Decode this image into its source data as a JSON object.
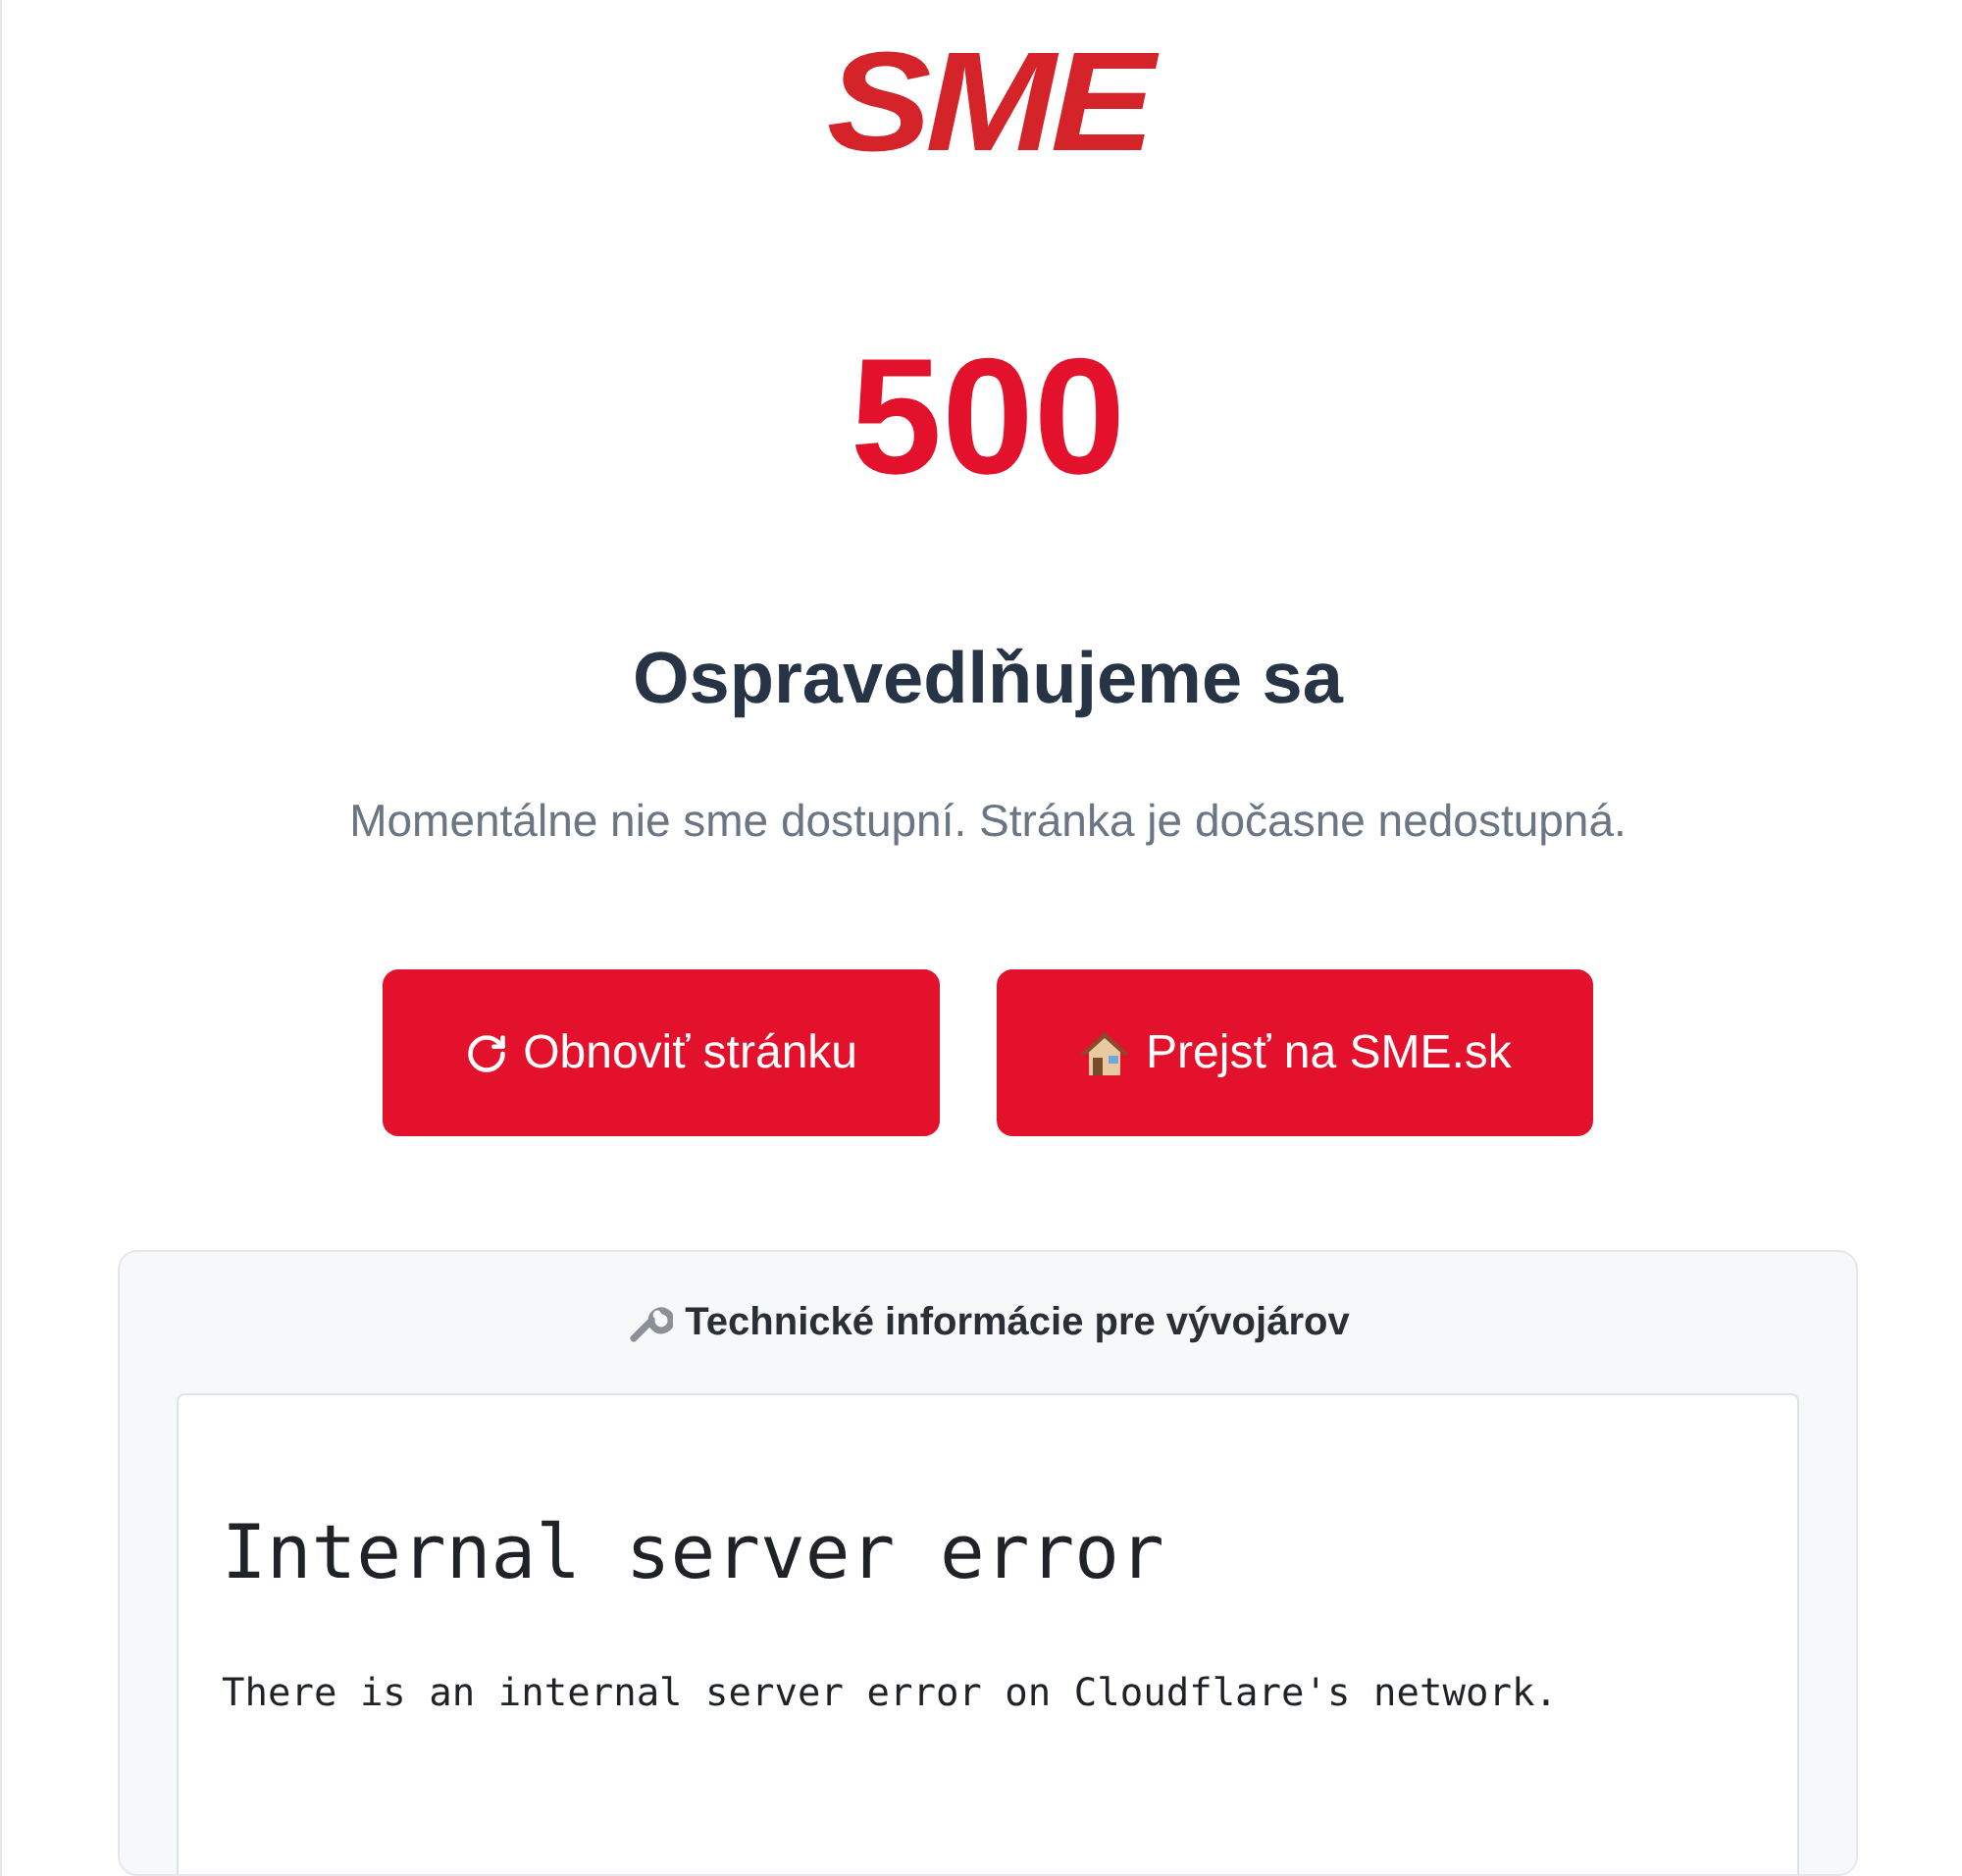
{
  "logo": "SME",
  "code": "500",
  "title": "Ospravedlňujeme sa",
  "message": "Momentálne nie sme dostupní. Stránka je dočasne nedostupná.",
  "buttons": [
    {
      "kind": "reload",
      "label": "Obnoviť stránku"
    },
    {
      "kind": "home",
      "label": "Prejsť na SME.sk"
    }
  ],
  "technical": {
    "title": "Technické informácie pre vývojárov",
    "error_title": "Internal server error",
    "error_text": "There is an internal server error on Cloudflare's network."
  }
}
